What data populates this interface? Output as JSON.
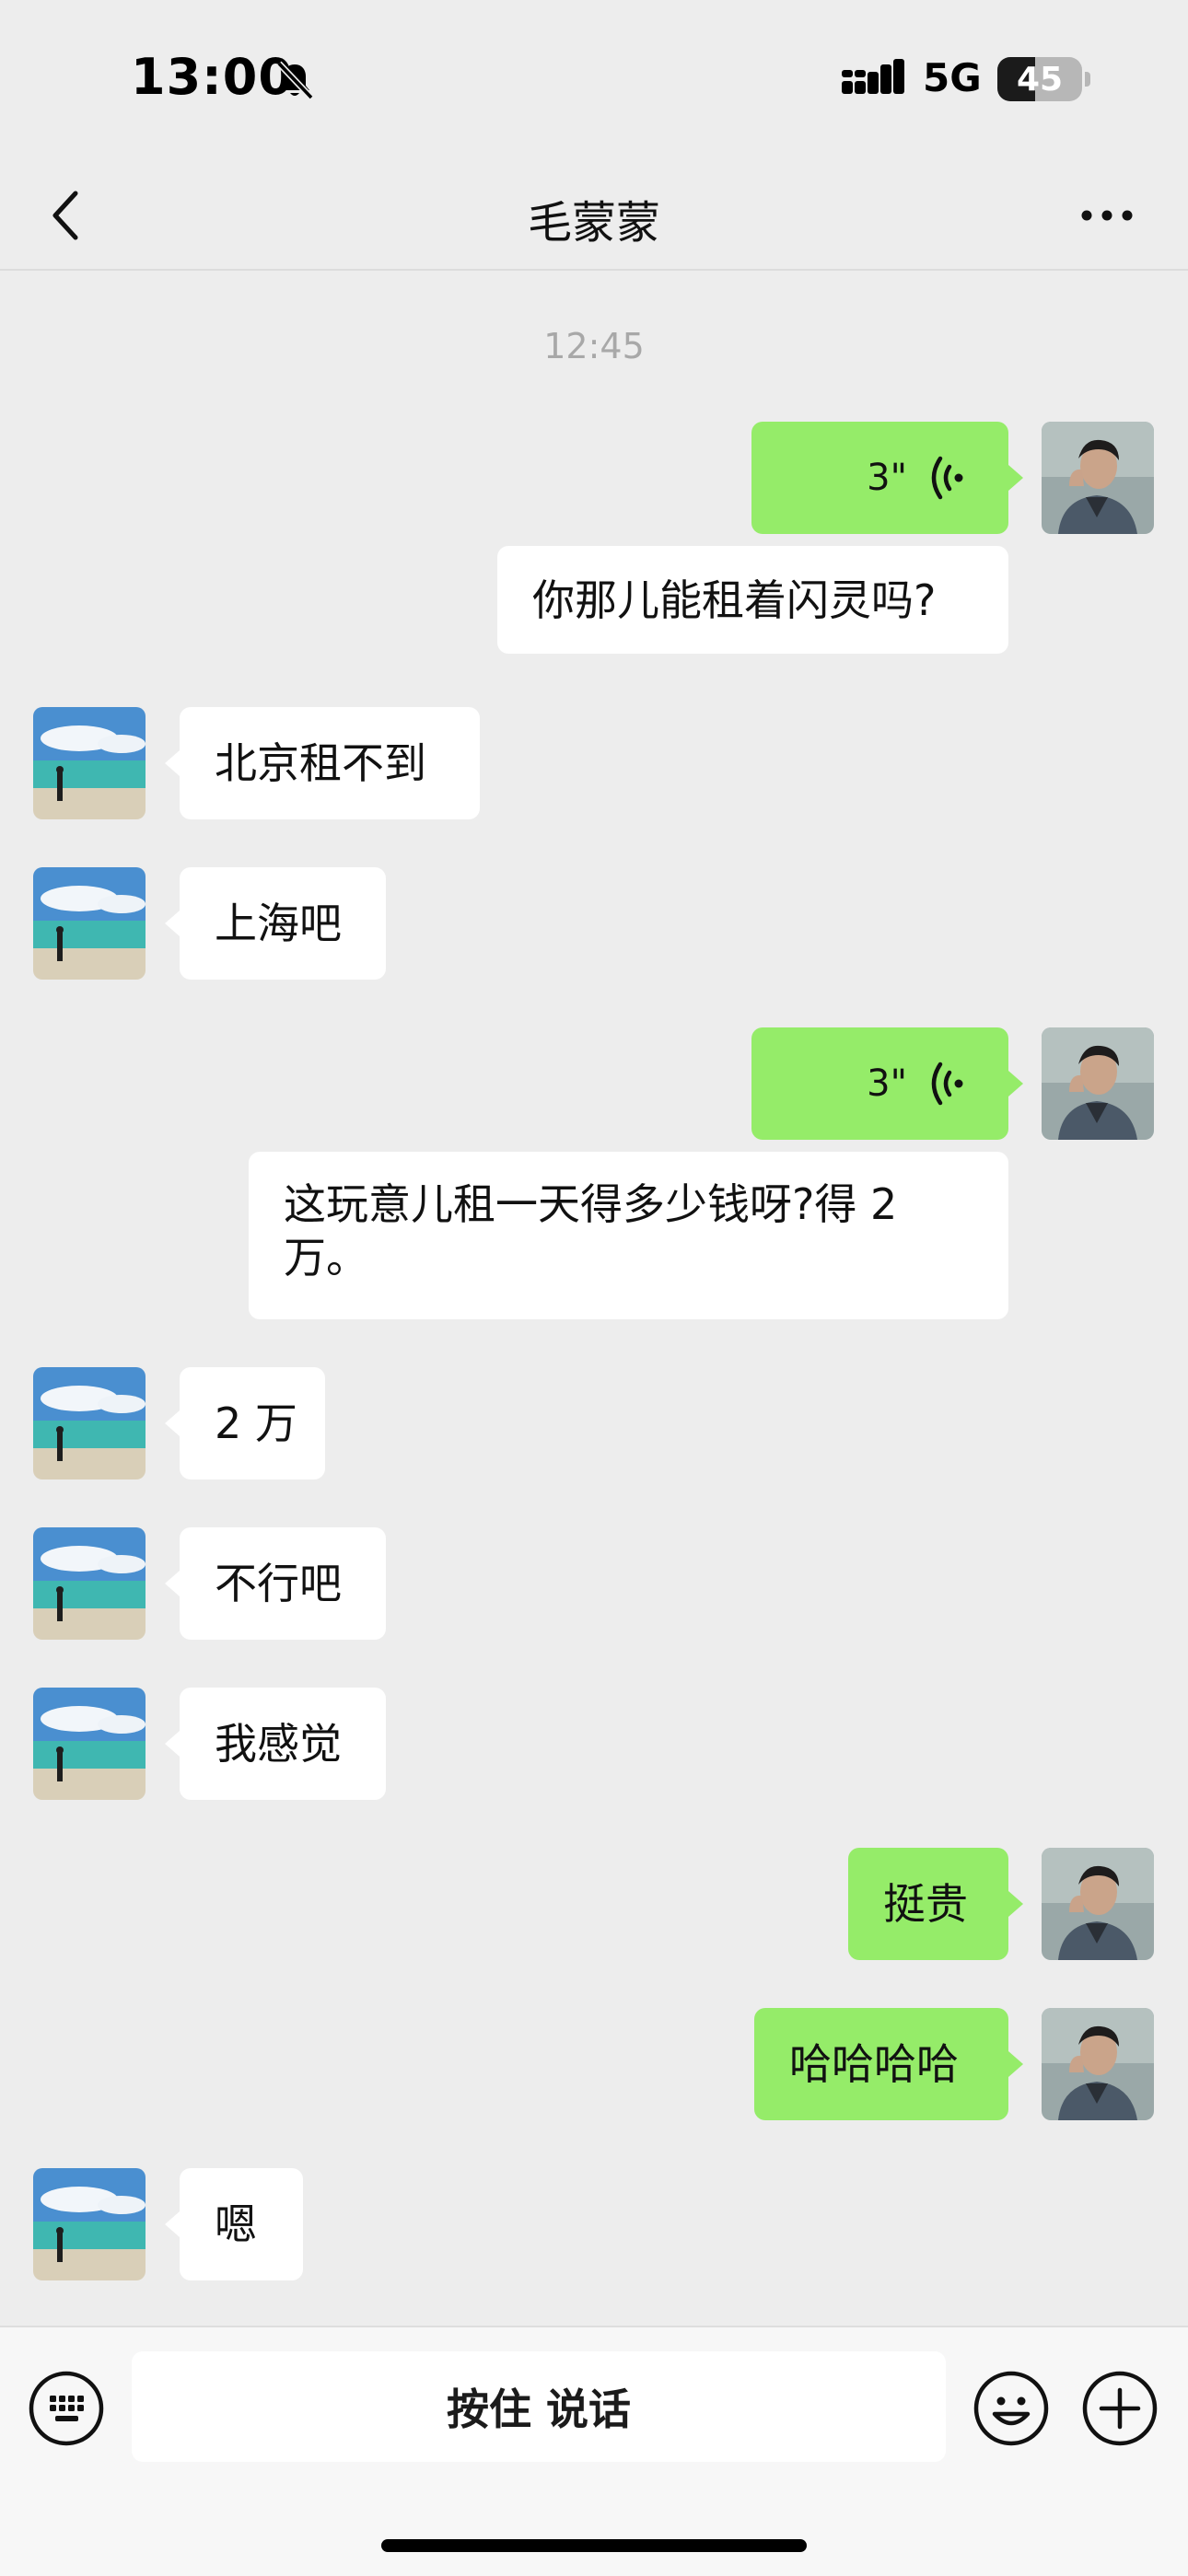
{
  "status_bar": {
    "time": "13:00",
    "network": "5G",
    "battery_level": "45",
    "battery_fraction": 0.45,
    "icons": [
      "bell-muted-icon",
      "cellular-signal-icon",
      "battery-icon"
    ]
  },
  "nav": {
    "title": "毛蒙蒙",
    "back_icon": "chevron-left-icon",
    "more_icon": "ellipsis-icon"
  },
  "chat": {
    "timestamp": "12:45",
    "messages": [
      {
        "sender": "me",
        "type": "voice",
        "duration": "3\"",
        "transcript": "你那儿能租着闪灵吗?"
      },
      {
        "sender": "other",
        "type": "text",
        "text": "北京租不到"
      },
      {
        "sender": "other",
        "type": "text",
        "text": "上海吧"
      },
      {
        "sender": "me",
        "type": "voice",
        "duration": "3\"",
        "transcript_line1": "这玩意儿租一天得多少钱呀?得 2",
        "transcript_line2": "万。"
      },
      {
        "sender": "other",
        "type": "text",
        "text": "2 万"
      },
      {
        "sender": "other",
        "type": "text",
        "text": "不行吧"
      },
      {
        "sender": "other",
        "type": "text",
        "text": "我感觉"
      },
      {
        "sender": "me",
        "type": "text",
        "text": "挺贵"
      },
      {
        "sender": "me",
        "type": "text",
        "text": "哈哈哈哈"
      },
      {
        "sender": "other",
        "type": "text",
        "text": "嗯"
      }
    ]
  },
  "input_bar": {
    "hold_to_talk_label": "按住 说话",
    "left_icon": "keyboard-icon",
    "emoji_icon": "smiley-icon",
    "plus_icon": "plus-circle-icon"
  },
  "colors": {
    "background": "#ededed",
    "my_bubble": "#95ec69",
    "their_bubble": "#ffffff",
    "timestamp": "#a8a8a8"
  }
}
